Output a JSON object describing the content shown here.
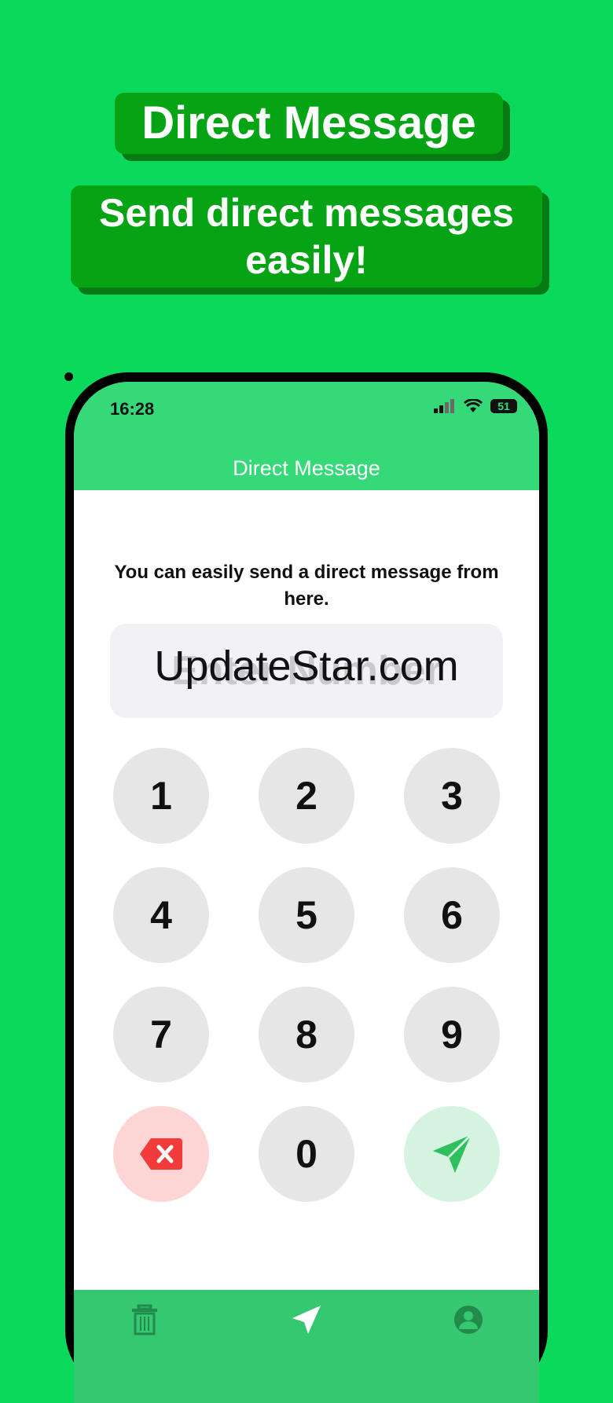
{
  "banner": {
    "title": "Direct Message",
    "subtitle": "Send direct messages easily!"
  },
  "status_bar": {
    "time": "16:28",
    "battery": "51"
  },
  "nav": {
    "title": "Direct Message"
  },
  "main": {
    "instruction": "You can easily send a direct message from here.",
    "number_field": {
      "placeholder": "Enter Number",
      "watermark": "UpdateStar.com"
    }
  },
  "keypad": {
    "keys": [
      "1",
      "2",
      "3",
      "4",
      "5",
      "6",
      "7",
      "8",
      "9",
      "0"
    ],
    "delete_icon": "backspace-icon",
    "send_icon": "send-icon"
  },
  "tabbar": {
    "icons": [
      "trash-icon",
      "send-icon",
      "profile-icon"
    ]
  },
  "colors": {
    "background": "#0bd95c",
    "banner": "#05a414",
    "header": "#35d978",
    "delete_key": "#fdd5d5",
    "send_key": "#d5f4df"
  }
}
